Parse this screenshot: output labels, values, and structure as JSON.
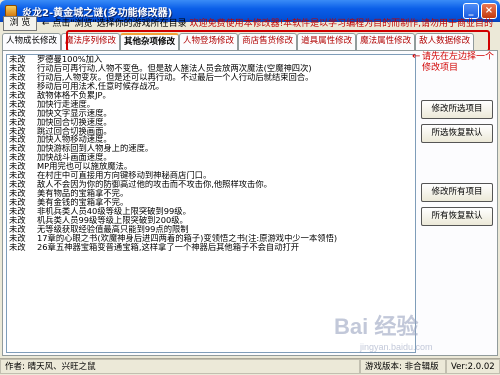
{
  "window": {
    "title": "炎龙2-黄金城之谜(多功能修改器)"
  },
  "toolbar": {
    "browse_label": "浏 览",
    "tip_prefix": "← 点击\"浏览\"选择你的游戏所在目录",
    "tip_red": "欢迎免费使用本修改器!本软件是以学习编程为目的而制作,请勿用于商业目的"
  },
  "tabs": [
    {
      "label": "人物成长修改"
    },
    {
      "label": "魔法序列修改"
    },
    {
      "label": "其他杂项修改"
    },
    {
      "label": "人物登场修改"
    },
    {
      "label": "商店售货修改"
    },
    {
      "label": "道具属性修改"
    },
    {
      "label": "魔法属性修改"
    },
    {
      "label": "敌人数据修改"
    }
  ],
  "note": {
    "arrow": "←",
    "text": "请先在左边择一个修改项目"
  },
  "list": [
    {
      "status": "未改",
      "text": "罗德曼100%加入"
    },
    {
      "status": "未改",
      "text": "行动后可再行动,人物不变色。但是敌人施法人员会放两次魔法(空魔神四次)"
    },
    {
      "status": "未改",
      "text": "行动后,人物变灰。但是还可以再行动。不过最后一个人行动后就结束回合。"
    },
    {
      "status": "未改",
      "text": "移动后可用法术,任意时候存战况。"
    },
    {
      "status": "未改",
      "text": "敌物体格不负累JP。"
    },
    {
      "status": "未改",
      "text": "加快行走速度。"
    },
    {
      "status": "未改",
      "text": "加快文字显示速度。"
    },
    {
      "status": "未改",
      "text": "加快回合切换速度。"
    },
    {
      "status": "未改",
      "text": "跳过回合切换画面。"
    },
    {
      "status": "未改",
      "text": "加快人物移动速度。"
    },
    {
      "status": "未改",
      "text": "加快游标回到人物身上的速度。"
    },
    {
      "status": "未改",
      "text": "加快战斗画面速度。"
    },
    {
      "status": "未改",
      "text": "MP用完也可以施放魔法。"
    },
    {
      "status": "未改",
      "text": "在村庄中可直接用方向键移动到神秘商店门口。"
    },
    {
      "status": "未改",
      "text": "敌人不会因为你的防御高过他的攻击而不攻击你,他照样攻击你。"
    },
    {
      "status": "未改",
      "text": "美有物品的宝箱拿不完。"
    },
    {
      "status": "未改",
      "text": "美有金钱的宝箱拿不完。"
    },
    {
      "status": "未改",
      "text": "非机兵类人员40级等级上限突破到99级。"
    },
    {
      "status": "未改",
      "text": "机兵类人员99级等级上限突破到200级。"
    },
    {
      "status": "未改",
      "text": "无等级获取经验值最高只能到99点的限制"
    },
    {
      "status": "未改",
      "text": "17章的心眼之书(欢魔神身后进四两着的箱子)变领悟之书(注:原游戏中少一本领悟)"
    },
    {
      "status": "未改",
      "text": "26章五神器宝箱变普通宝箱,这样拿了一个神器后其他箱子不会自动打开"
    }
  ],
  "buttons": {
    "modify_selected": "修改所选项目",
    "restore_selected": "所选恢复默认",
    "modify_all": "修改所有项目",
    "restore_all": "所有恢复默认"
  },
  "status": {
    "author": "作者: 晴天风、兴旺之鼠",
    "version_label": "游戏版本: 非合辑版",
    "version": "Ver:2.0.02"
  },
  "watermark": {
    "text": "Bai 经验",
    "sub": "jingyan.baidu.com"
  }
}
